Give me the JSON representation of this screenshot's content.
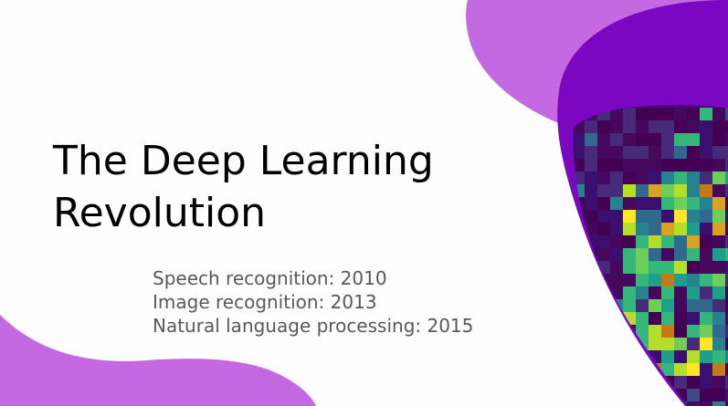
{
  "slide": {
    "title_line1": "The Deep Learning",
    "title_line2": "Revolution",
    "bullets": [
      "Speech recognition: 2010",
      "Image recognition: 2013",
      "Natural language processing: 2015"
    ]
  },
  "colors": {
    "background": "#fdfdfd",
    "title_text": "#000000",
    "body_text": "#595959",
    "blob_light_purple": "#c569e2",
    "blob_dark_purple": "#7b07c3",
    "heatmap_base": "#44057d"
  },
  "decor": {
    "heatmap_image": "pixel-heatmap-image",
    "top_blob": "purple-blob-shape",
    "bottom_blob": "purple-blob-shape"
  }
}
